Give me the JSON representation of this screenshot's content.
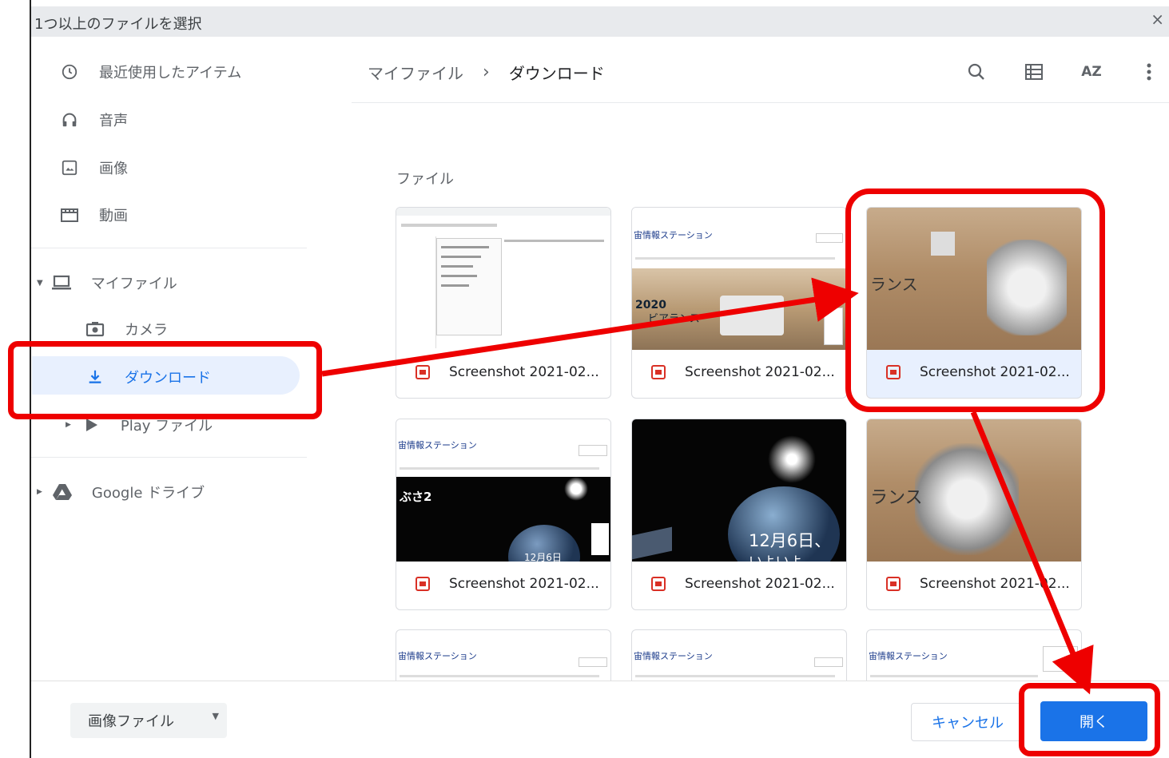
{
  "dialog": {
    "title": "1つ以上のファイルを選択",
    "close_label": "×"
  },
  "sidebar": {
    "items": [
      {
        "label": "最近使用したアイテム",
        "icon": "clock-icon"
      },
      {
        "label": "音声",
        "icon": "headphones-icon"
      },
      {
        "label": "画像",
        "icon": "image-icon"
      },
      {
        "label": "動画",
        "icon": "movie-icon"
      },
      {
        "label": "マイファイル",
        "icon": "laptop-icon"
      },
      {
        "label": "カメラ",
        "icon": "camera-icon"
      },
      {
        "label": "ダウンロード",
        "icon": "download-icon"
      },
      {
        "label": "Play ファイル",
        "icon": "play-icon"
      },
      {
        "label": "Google ドライブ",
        "icon": "drive-icon"
      }
    ]
  },
  "breadcrumb": {
    "root": "マイファイル",
    "separator": "›",
    "current": "ダウンロード"
  },
  "toolbar": {
    "search_icon": "search-icon",
    "view_icon": "list-view-icon",
    "sort_label": "AZ",
    "more_icon": "more-vert-icon"
  },
  "section_label": "ファイル",
  "files": [
    {
      "name": "Screenshot 2021-02..."
    },
    {
      "name": "Screenshot 2021-02..."
    },
    {
      "name": "Screenshot 2021-02..."
    },
    {
      "name": "Screenshot 2021-02..."
    },
    {
      "name": "Screenshot 2021-02..."
    },
    {
      "name": "Screenshot 2021-02..."
    }
  ],
  "thumb_text": {
    "station": "宙情報ステーション",
    "perseverance": "ランス",
    "year": "2020",
    "perseverance2": "ビアランス",
    "space": "ぶさ2",
    "date": "12月6日、",
    "date2": "12月6日",
    "date3": "いよいよ"
  },
  "footer": {
    "filetype": "画像ファイル",
    "cancel": "キャンセル",
    "open": "開く"
  },
  "colors": {
    "accent": "#1a73e8",
    "highlight": "#ee0000",
    "selected_bg": "#e8f0fe"
  }
}
